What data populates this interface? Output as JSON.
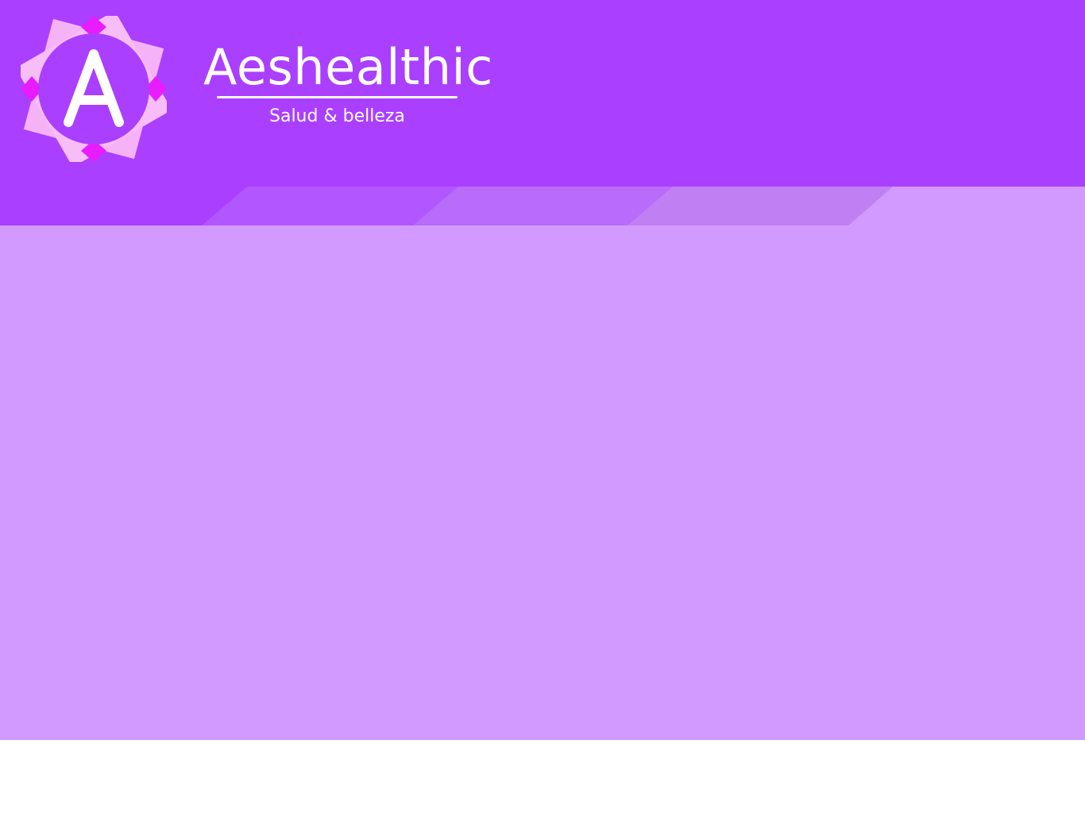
{
  "brand": {
    "name": "Aeshealthic",
    "tagline": "Salud & belleza",
    "logo_letter": "A",
    "logo_icon": "sunburst-a-logo"
  },
  "colors": {
    "header_bg": "#aa3fff",
    "content_bg": "#d29aff",
    "tab_1": "#b257ff",
    "tab_2": "#b96bf9",
    "tab_3": "#c17ff4",
    "logo_petal_light": "#f7b8f7",
    "logo_petal_mid": "#ef85f1",
    "logo_petal_accent": "#e81cff",
    "text": "#ffffff",
    "footer_bg": "#ffffff"
  },
  "nav": {
    "tabs": [
      {
        "label": ""
      },
      {
        "label": ""
      },
      {
        "label": ""
      }
    ]
  }
}
